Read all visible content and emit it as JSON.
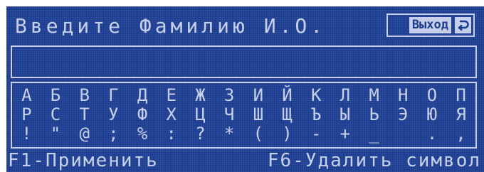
{
  "header": {
    "title": "Введите Фамилию И.О.",
    "exit_label": "Выход",
    "exit_icon": "return-arrow-icon"
  },
  "input": {
    "value": ""
  },
  "keyboard": {
    "rows": [
      [
        "А",
        "Б",
        "В",
        "Г",
        "Д",
        "Е",
        "Ж",
        "З",
        "И",
        "Й",
        "К",
        "Л",
        "М",
        "Н",
        "О",
        "П"
      ],
      [
        "Р",
        "С",
        "Т",
        "У",
        "Ф",
        "Х",
        "Ц",
        "Ч",
        "Ш",
        "Щ",
        "Ъ",
        "Ы",
        "Ь",
        "Э",
        "Ю",
        "Я"
      ],
      [
        "!",
        "\"",
        "@",
        ";",
        "%",
        ":",
        "?",
        "*",
        "(",
        ")",
        "-",
        "+",
        "_",
        " ",
        ".",
        ","
      ]
    ]
  },
  "footer": {
    "apply": "F1-Применить",
    "delete": "F6-Удалить символ"
  },
  "colors": {
    "background": "#1d3d8f",
    "foreground": "#c6d0ea"
  }
}
